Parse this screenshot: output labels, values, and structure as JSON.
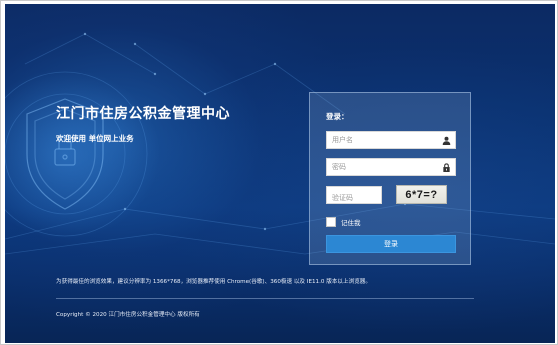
{
  "brand": {
    "title": "江门市住房公积金管理中心",
    "subtitle": "欢迎使用 单位网上业务"
  },
  "login": {
    "title": "登录：",
    "username_placeholder": "用户名",
    "password_placeholder": "密码",
    "captcha_placeholder": "验证码",
    "captcha_text": "6*7=?",
    "remember_label": "记住我",
    "submit_label": "登录",
    "username_icon": "user-icon",
    "password_icon": "lock-icon"
  },
  "footer": {
    "browser_note": "为获得最佳的浏览效果，建议分辨率为 1366*768，浏览器推荐使用 Chrome(谷歌)、360极速 以及 IE11.0 版本以上浏览器。",
    "copyright": "Copyright © 2020 江门市住房公积金管理中心 版权所有"
  },
  "colors": {
    "background_dark": "#0a2f6c",
    "button_blue": "#2c87d3"
  }
}
